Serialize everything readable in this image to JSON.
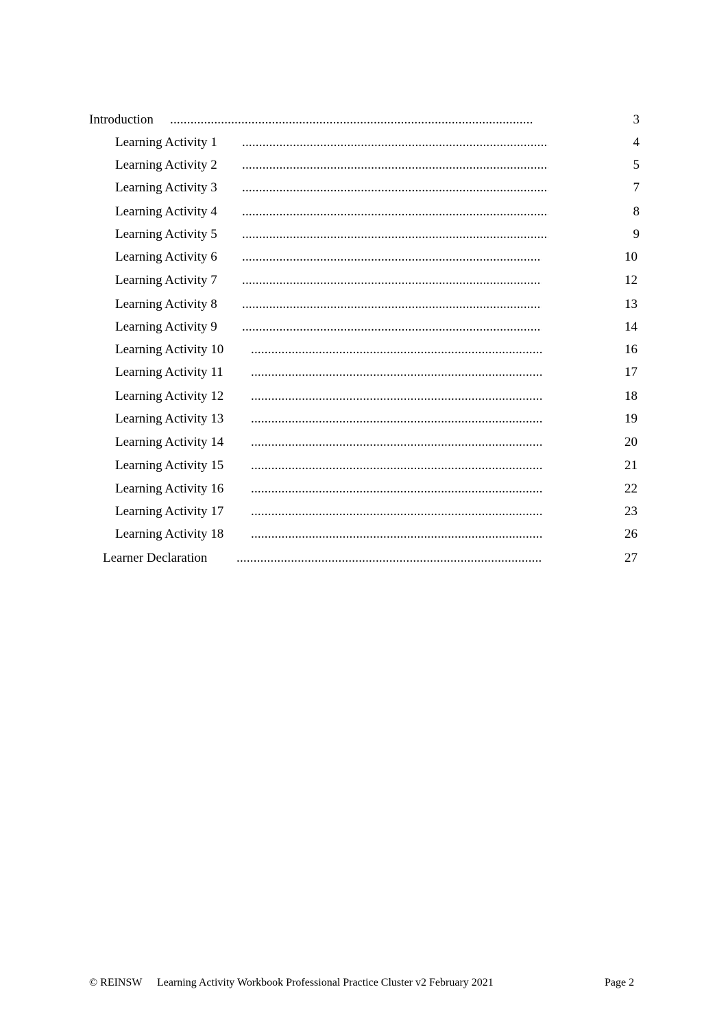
{
  "toc": {
    "entries": [
      {
        "title": "Introduction",
        "page": "3",
        "level": 0
      },
      {
        "title": "Learning Activity 1",
        "page": "4",
        "level": 1
      },
      {
        "title": "Learning Activity 2",
        "page": "5",
        "level": 1
      },
      {
        "title": "Learning Activity 3",
        "page": "7",
        "level": 1
      },
      {
        "title": "Learning Activity 4",
        "page": "8",
        "level": 1
      },
      {
        "title": "Learning Activity 5",
        "page": "9",
        "level": 1
      },
      {
        "title": "Learning Activity 6",
        "page": "10",
        "level": 1
      },
      {
        "title": "Learning Activity 7",
        "page": "12",
        "level": 1
      },
      {
        "title": "Learning Activity 8",
        "page": "13",
        "level": 1
      },
      {
        "title": "Learning Activity 9",
        "page": "14",
        "level": 1
      },
      {
        "title": "Learning Activity 10",
        "page": "16",
        "level": 1
      },
      {
        "title": "Learning Activity 11",
        "page": "17",
        "level": 1
      },
      {
        "title": "Learning Activity 12",
        "page": "18",
        "level": 1
      },
      {
        "title": "Learning Activity 13",
        "page": "19",
        "level": 1
      },
      {
        "title": "Learning Activity 14",
        "page": "20",
        "level": 1
      },
      {
        "title": "Learning Activity 15",
        "page": "21",
        "level": 1
      },
      {
        "title": "Learning Activity 16",
        "page": "22",
        "level": 1
      },
      {
        "title": "Learning Activity 17",
        "page": "23",
        "level": 1
      },
      {
        "title": "Learning Activity 18",
        "page": "26",
        "level": 1
      },
      {
        "title": "Learner Declaration",
        "page": "27",
        "level": 2
      }
    ],
    "leader": "........................................................................................................................"
  },
  "footer": {
    "copyright": "© REINSW",
    "document_title": "Learning Activity Workbook Professional Practice Cluster v2 February 2021",
    "page_label": "Page 2"
  }
}
